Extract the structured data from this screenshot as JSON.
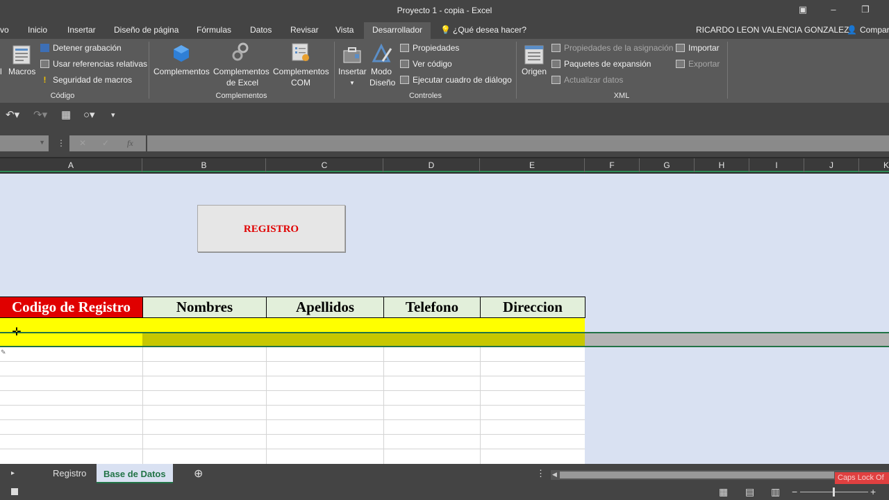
{
  "window": {
    "title": "Proyecto 1 - copia - Excel",
    "user": "RICARDO LEON VALENCIA GONZALEZ",
    "share": "Compar"
  },
  "tabs": [
    "vo",
    "Inicio",
    "Insertar",
    "Diseño de página",
    "Fórmulas",
    "Datos",
    "Revisar",
    "Vista",
    "Desarrollador"
  ],
  "tell_me": "¿Qué desea hacer?",
  "ribbon": {
    "codigo": {
      "label": "Código",
      "big": [
        "l",
        "Macros"
      ],
      "small": [
        "Detener grabación",
        "Usar referencias relativas",
        "Seguridad de macros"
      ]
    },
    "complementos": {
      "label": "Complementos",
      "buttons": [
        "Complementos",
        "Complementos",
        "de Excel",
        "Complementos",
        "COM"
      ]
    },
    "controles": {
      "label": "Controles",
      "buttons": [
        "Insertar",
        "Modo",
        "Diseño"
      ],
      "small": [
        "Propiedades",
        "Ver código",
        "Ejecutar cuadro de diálogo"
      ]
    },
    "xml": {
      "label": "XML",
      "big": "Origen",
      "small": [
        "Propiedades de la asignación",
        "Paquetes de expansión",
        "Actualizar datos",
        "Importar",
        "Exportar"
      ]
    }
  },
  "formula_bar": {
    "fx": "fx"
  },
  "columns": [
    "A",
    "B",
    "C",
    "D",
    "E",
    "F",
    "G",
    "H",
    "I",
    "J",
    "K"
  ],
  "sheet": {
    "button_label": "REGISTRO",
    "headers": [
      "Codigo de Registro",
      "Nombres",
      "Apellidos",
      "Telefono",
      "Direccion"
    ]
  },
  "sheet_tabs": [
    "Registro",
    "Base de Datos"
  ],
  "status": {
    "caps": "Caps Lock Of"
  },
  "colors": {
    "accent_green": "#217346",
    "header_red": "#e00000",
    "header_green": "#e2efda",
    "highlight_yellow": "#ffff00",
    "sheet_bg": "#d9e1f2"
  }
}
